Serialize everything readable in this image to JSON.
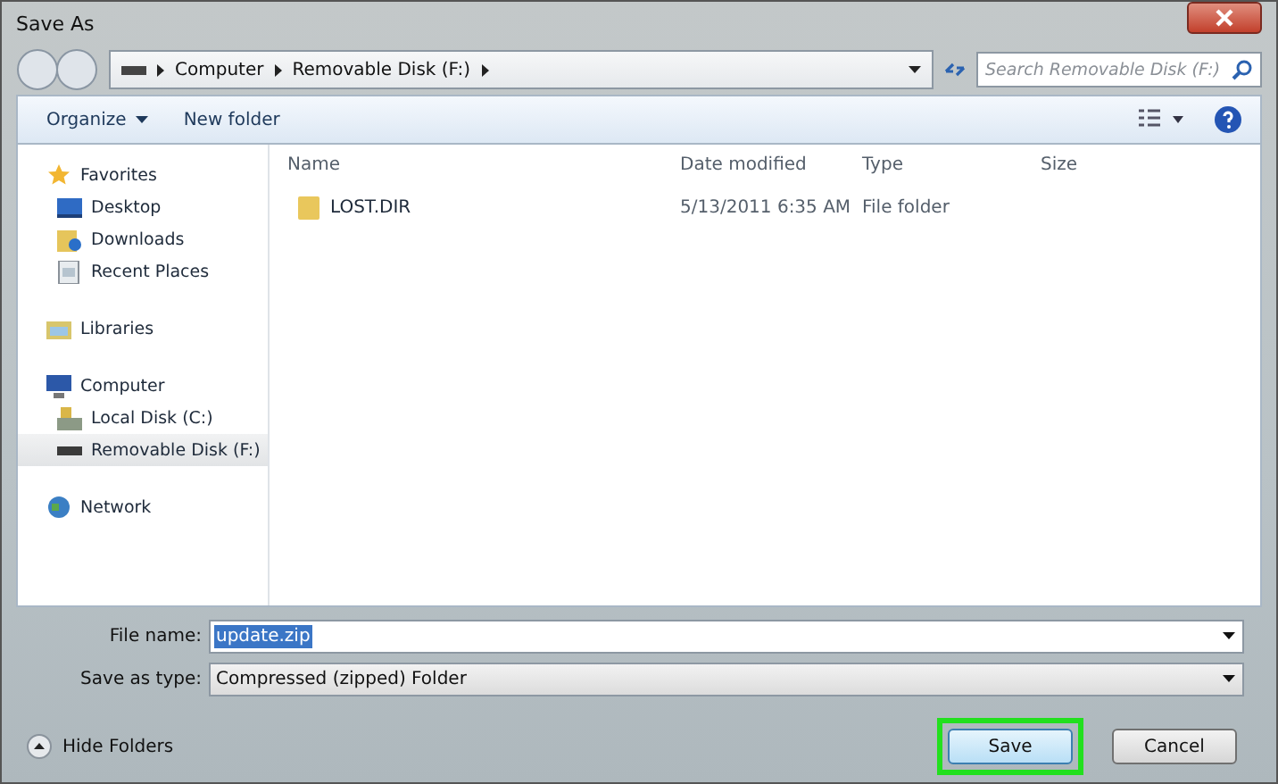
{
  "window": {
    "title": "Save As"
  },
  "address_bar": {
    "crumbs": [
      "Computer",
      "Removable Disk (F:)"
    ]
  },
  "search": {
    "placeholder": "Search Removable Disk (F:)"
  },
  "toolbar": {
    "items": [
      "Organize",
      "New folder"
    ]
  },
  "sidebar": {
    "groups": [
      {
        "label": "Favorites",
        "children": [
          {
            "label": "Desktop",
            "selected": false
          },
          {
            "label": "Downloads",
            "selected": false
          },
          {
            "label": "Recent Places",
            "selected": false
          }
        ]
      },
      {
        "label": "Libraries"
      },
      {
        "label": "Computer",
        "children": [
          {
            "label": "Local Disk (C:)",
            "selected": false
          },
          {
            "label": "Removable Disk (F:)",
            "selected": true
          }
        ]
      },
      {
        "label": "Network"
      }
    ]
  },
  "file_list": {
    "columns": [
      "Name",
      "Date modified",
      "Type",
      "Size"
    ],
    "rows": [
      {
        "name": "LOST.DIR",
        "date": "5/13/2011 6:35 AM",
        "type": "File folder"
      }
    ]
  },
  "file_name": {
    "label": "File name:",
    "value": "update.zip",
    "selected": true
  },
  "save_as_type": {
    "label": "Save as type:",
    "value": "Compressed (zipped) Folder"
  },
  "hide_folders": "Hide Folders",
  "buttons": [
    {
      "label": "Save",
      "highlighted": true
    },
    {
      "label": "Cancel",
      "highlighted": false
    }
  ]
}
